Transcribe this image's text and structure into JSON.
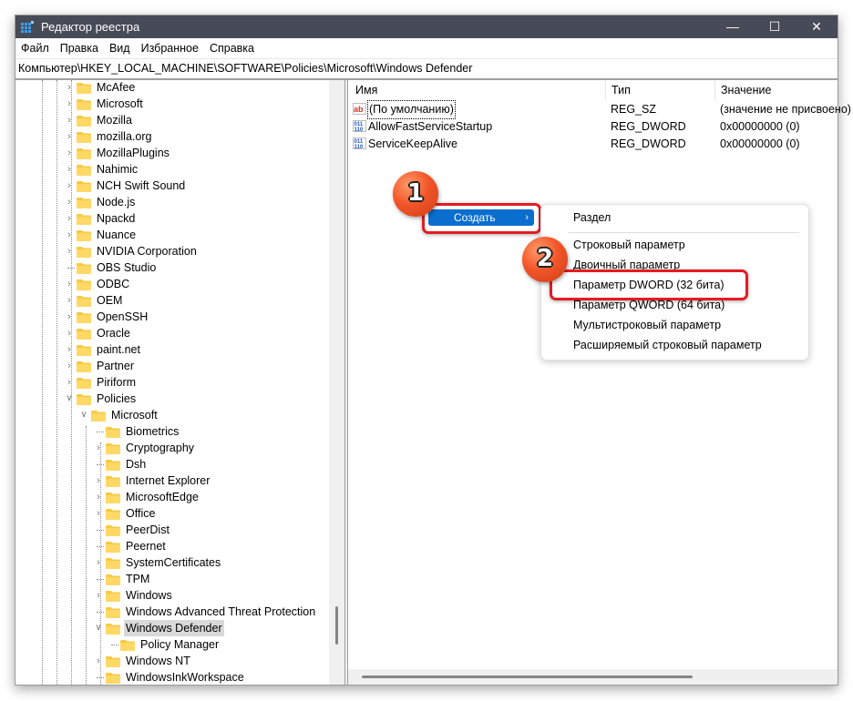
{
  "window": {
    "title": "Редактор реестра",
    "controls": {
      "minimize": "—",
      "maximize": "☐",
      "close": "✕"
    }
  },
  "menu": [
    "Файл",
    "Правка",
    "Вид",
    "Избранное",
    "Справка"
  ],
  "address": "Компьютер\\HKEY_LOCAL_MACHINE\\SOFTWARE\\Policies\\Microsoft\\Windows Defender",
  "tree": [
    {
      "label": "McAfee",
      "level": 0,
      "state": "collapsed"
    },
    {
      "label": "Microsoft",
      "level": 0,
      "state": "collapsed"
    },
    {
      "label": "Mozilla",
      "level": 0,
      "state": "collapsed"
    },
    {
      "label": "mozilla.org",
      "level": 0,
      "state": "collapsed"
    },
    {
      "label": "MozillaPlugins",
      "level": 0,
      "state": "collapsed"
    },
    {
      "label": "Nahimic",
      "level": 0,
      "state": "collapsed"
    },
    {
      "label": "NCH Swift Sound",
      "level": 0,
      "state": "collapsed"
    },
    {
      "label": "Node.js",
      "level": 0,
      "state": "collapsed"
    },
    {
      "label": "Npackd",
      "level": 0,
      "state": "collapsed"
    },
    {
      "label": "Nuance",
      "level": 0,
      "state": "collapsed"
    },
    {
      "label": "NVIDIA Corporation",
      "level": 0,
      "state": "collapsed"
    },
    {
      "label": "OBS Studio",
      "level": 0,
      "state": "leaf"
    },
    {
      "label": "ODBC",
      "level": 0,
      "state": "collapsed"
    },
    {
      "label": "OEM",
      "level": 0,
      "state": "collapsed"
    },
    {
      "label": "OpenSSH",
      "level": 0,
      "state": "collapsed"
    },
    {
      "label": "Oracle",
      "level": 0,
      "state": "collapsed"
    },
    {
      "label": "paint.net",
      "level": 0,
      "state": "collapsed"
    },
    {
      "label": "Partner",
      "level": 0,
      "state": "collapsed"
    },
    {
      "label": "Piriform",
      "level": 0,
      "state": "collapsed"
    },
    {
      "label": "Policies",
      "level": 0,
      "state": "expanded"
    },
    {
      "label": "Microsoft",
      "level": 1,
      "state": "expanded"
    },
    {
      "label": "Biometrics",
      "level": 2,
      "state": "leaf"
    },
    {
      "label": "Cryptography",
      "level": 2,
      "state": "collapsed"
    },
    {
      "label": "Dsh",
      "level": 2,
      "state": "leaf"
    },
    {
      "label": "Internet Explorer",
      "level": 2,
      "state": "collapsed"
    },
    {
      "label": "MicrosoftEdge",
      "level": 2,
      "state": "collapsed"
    },
    {
      "label": "Office",
      "level": 2,
      "state": "collapsed"
    },
    {
      "label": "PeerDist",
      "level": 2,
      "state": "leaf"
    },
    {
      "label": "Peernet",
      "level": 2,
      "state": "leaf"
    },
    {
      "label": "SystemCertificates",
      "level": 2,
      "state": "collapsed"
    },
    {
      "label": "TPM",
      "level": 2,
      "state": "leaf"
    },
    {
      "label": "Windows",
      "level": 2,
      "state": "collapsed"
    },
    {
      "label": "Windows Advanced Threat Protection",
      "level": 2,
      "state": "leaf"
    },
    {
      "label": "Windows Defender",
      "level": 2,
      "state": "expanded",
      "selected": true
    },
    {
      "label": "Policy Manager",
      "level": 3,
      "state": "leaf"
    },
    {
      "label": "Windows NT",
      "level": 2,
      "state": "collapsed"
    },
    {
      "label": "WindowsInkWorkspace",
      "level": 2,
      "state": "leaf"
    }
  ],
  "values": {
    "headers": {
      "name": "Имя",
      "type": "Тип",
      "value": "Значение"
    },
    "rows": [
      {
        "name": "(По умолчанию)",
        "type": "REG_SZ",
        "value": "(значение не присвоено)",
        "icon": "string-value-icon"
      },
      {
        "name": "AllowFastServiceStartup",
        "type": "REG_DWORD",
        "value": "0x00000000 (0)",
        "icon": "binary-value-icon"
      },
      {
        "name": "ServiceKeepAlive",
        "type": "REG_DWORD",
        "value": "0x00000000 (0)",
        "icon": "binary-value-icon"
      }
    ]
  },
  "context_menu": {
    "create": "Создать",
    "arrow": "›"
  },
  "submenu": {
    "items": [
      "Раздел",
      "Строковый параметр",
      "Двоичный параметр",
      "Параметр DWORD (32 бита)",
      "Параметр QWORD (64 бита)",
      "Мультистроковый параметр",
      "Расширяемый строковый параметр"
    ]
  },
  "annotations": {
    "step1": "1",
    "step2": "2",
    "highlight_color": "#e41c23",
    "badge_color": "#f2562a"
  },
  "colors": {
    "titlebar": "#474b57",
    "menu_highlight": "#0a6ecf",
    "folder": "#f8c93f"
  }
}
